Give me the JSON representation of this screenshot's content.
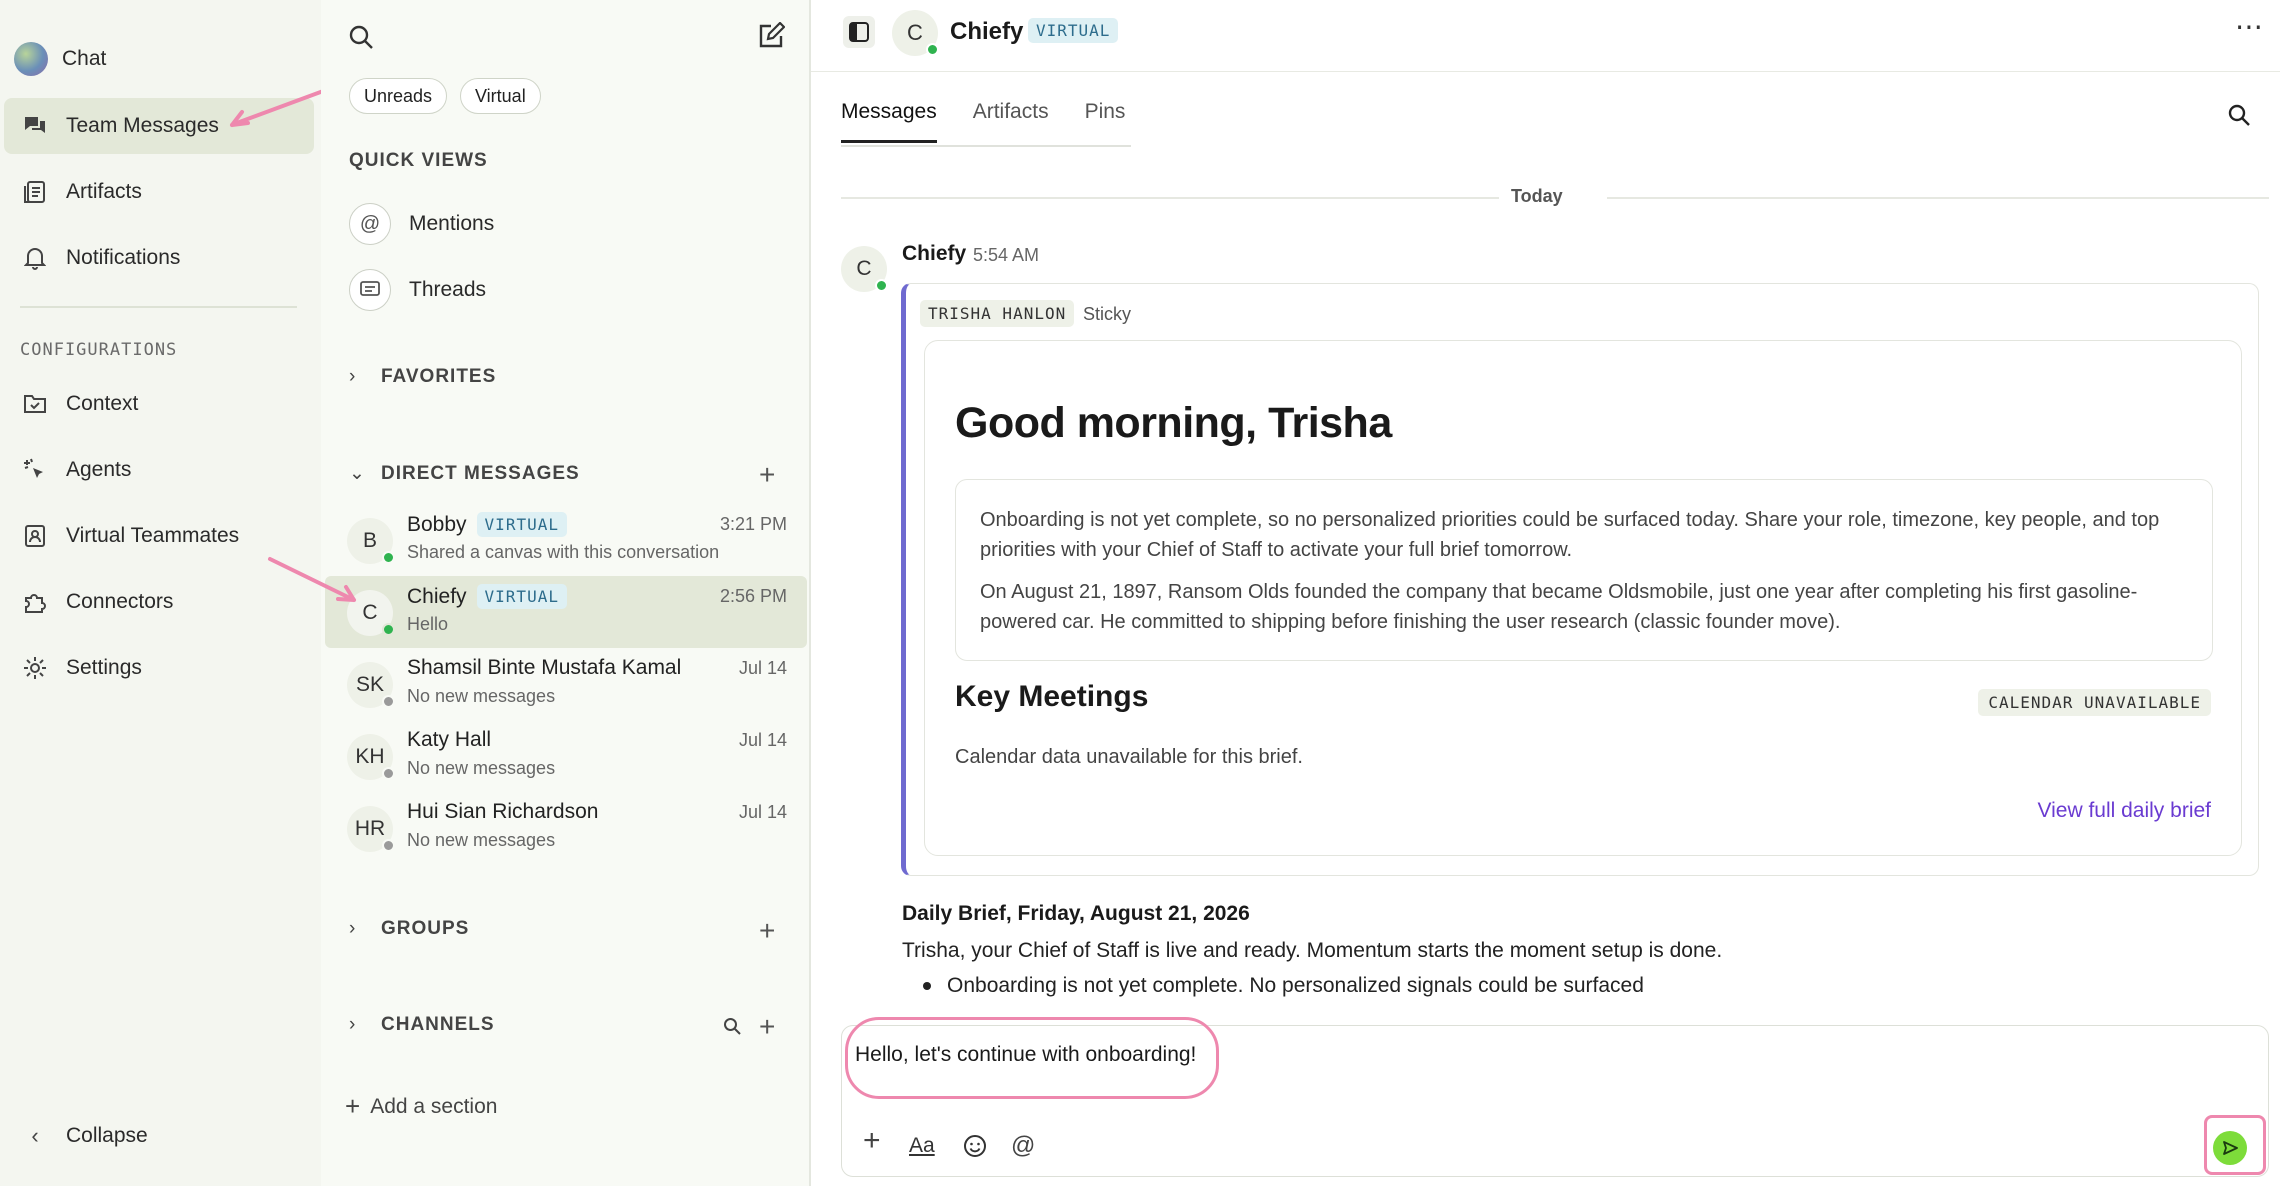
{
  "nav": {
    "app_name": "Chat",
    "items": [
      {
        "label": "Team Messages",
        "icon": "chat-bubbles-icon"
      },
      {
        "label": "Artifacts",
        "icon": "document-list-icon"
      },
      {
        "label": "Notifications",
        "icon": "bell-icon"
      }
    ],
    "section_label": "CONFIGURATIONS",
    "config_items": [
      {
        "label": "Context",
        "icon": "folder-check-icon"
      },
      {
        "label": "Agents",
        "icon": "sparkle-cursor-icon"
      },
      {
        "label": "Virtual Teammates",
        "icon": "id-badge-icon"
      },
      {
        "label": "Connectors",
        "icon": "puzzle-icon"
      },
      {
        "label": "Settings",
        "icon": "gear-icon"
      }
    ],
    "collapse_label": "Collapse"
  },
  "middle": {
    "filters": [
      "Unreads",
      "Virtual"
    ],
    "quick_views_title": "QUICK VIEWS",
    "quick_views": [
      {
        "label": "Mentions",
        "icon": "at-icon"
      },
      {
        "label": "Threads",
        "icon": "thread-icon"
      }
    ],
    "favorites_title": "FAVORITES",
    "dm_title": "DIRECT MESSAGES",
    "dms": [
      {
        "initials": "B",
        "name": "Bobby",
        "tag": "VIRTUAL",
        "preview": "Shared a canvas with this conversation",
        "time": "3:21 PM",
        "status": "online"
      },
      {
        "initials": "C",
        "name": "Chiefy",
        "tag": "VIRTUAL",
        "preview": "Hello",
        "time": "2:56 PM",
        "status": "online"
      },
      {
        "initials": "SK",
        "name": "Shamsil Binte Mustafa Kamal",
        "tag": "",
        "preview": "No new messages",
        "time": "Jul 14",
        "status": "offline"
      },
      {
        "initials": "KH",
        "name": "Katy Hall",
        "tag": "",
        "preview": "No new messages",
        "time": "Jul 14",
        "status": "offline"
      },
      {
        "initials": "HR",
        "name": "Hui Sian Richardson",
        "tag": "",
        "preview": "No new messages",
        "time": "Jul 14",
        "status": "offline"
      }
    ],
    "groups_title": "GROUPS",
    "channels_title": "CHANNELS",
    "add_section_label": "Add a section"
  },
  "main": {
    "header": {
      "avatar_initial": "C",
      "name": "Chiefy",
      "tag": "VIRTUAL"
    },
    "tabs": [
      "Messages",
      "Artifacts",
      "Pins"
    ],
    "date_divider": "Today",
    "message": {
      "author": "Chiefy",
      "time": "5:54 AM",
      "card_author_tag": "TRISHA HANLON",
      "card_label": "Sticky",
      "greeting": "Good morning, Trisha",
      "brief_p1": "Onboarding is not yet complete, so no personalized priorities could be surfaced today. Share your role, timezone, key people, and top priorities with your Chief of Staff to activate your full brief tomorrow.",
      "brief_p2": "On August 21, 1897, Ransom Olds founded the company that became Oldsmobile, just one year after completing his first gasoline-powered car. He committed to shipping before finishing the user research (classic founder move).",
      "meetings_title": "Key Meetings",
      "calendar_badge": "CALENDAR UNAVAILABLE",
      "calendar_text": "Calendar data unavailable for this brief.",
      "view_link": "View full daily brief",
      "daily_title": "Daily Brief, Friday, August 21, 2026",
      "daily_text": "Trisha, your Chief of Staff is live and ready. Momentum starts the moment setup is done.",
      "bullet1": "Onboarding is not yet complete. No personalized signals could be surfaced"
    },
    "composer": {
      "text": "Hello, let's continue with onboarding!",
      "format_label": "Aa"
    },
    "colors": {
      "accent_green": "#7ddc3a",
      "annotation_pink": "#ee88ae",
      "link_purple": "#6a3bd1"
    }
  }
}
